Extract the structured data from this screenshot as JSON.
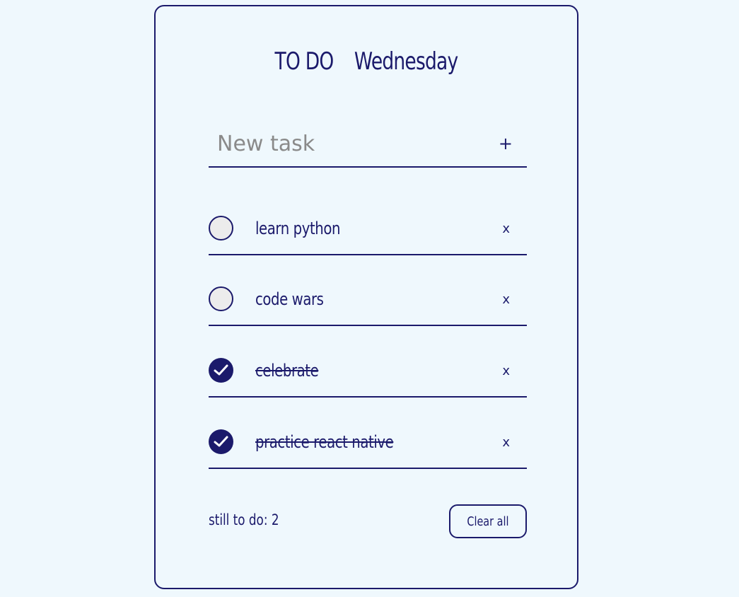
{
  "header": {
    "title_left": "TO DO",
    "title_right": "Wednesday"
  },
  "new_task": {
    "placeholder": "New task",
    "value": "",
    "add_label": "+"
  },
  "todos": [
    {
      "text": "learn python",
      "done": false,
      "delete_label": "x"
    },
    {
      "text": "code wars",
      "done": false,
      "delete_label": "x"
    },
    {
      "text": "celebrate",
      "done": true,
      "delete_label": "x"
    },
    {
      "text": "practice react native",
      "done": true,
      "delete_label": "x"
    }
  ],
  "footer": {
    "remaining_text": "still to do: 2",
    "clear_label": "Clear all"
  },
  "colors": {
    "background": "#eff8fd",
    "accent": "#1b1a6b",
    "unchecked_fill": "#ececec"
  }
}
